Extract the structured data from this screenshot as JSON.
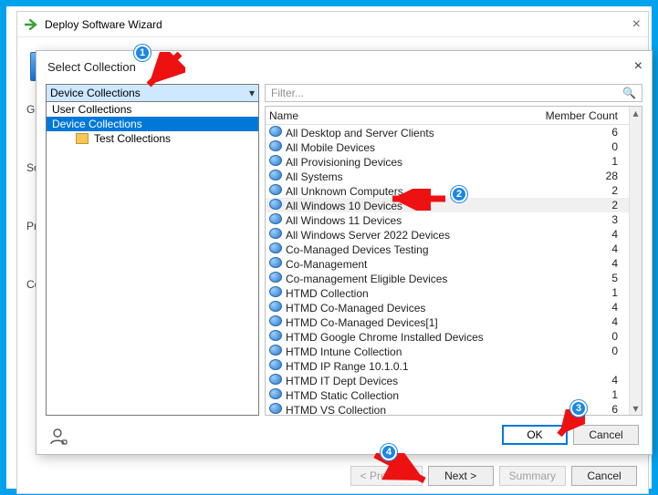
{
  "wizard": {
    "title": "Deploy Software Wizard",
    "side_labels": [
      "Ge",
      "So",
      "Pr",
      "Co"
    ],
    "buttons": {
      "previous": "< Previous",
      "next": "Next >",
      "summary": "Summary",
      "cancel": "Cancel"
    }
  },
  "modal": {
    "title": "Select Collection",
    "combo_value": "Device Collections",
    "tree": {
      "items": [
        "User Collections",
        "Device Collections"
      ],
      "sub_item": "Test Collections",
      "selected_index": 1
    },
    "filter_placeholder": "Filter...",
    "columns": {
      "name": "Name",
      "member": "Member Count"
    },
    "rows": [
      {
        "name": "All Desktop and Server Clients",
        "count": "6"
      },
      {
        "name": "All Mobile Devices",
        "count": "0"
      },
      {
        "name": "All Provisioning Devices",
        "count": "1"
      },
      {
        "name": "All Systems",
        "count": "28"
      },
      {
        "name": "All Unknown Computers",
        "count": "2"
      },
      {
        "name": "All Windows 10 Devices",
        "count": "2",
        "highlight": true
      },
      {
        "name": "All Windows 11 Devices",
        "count": "3"
      },
      {
        "name": "All Windows Server 2022 Devices",
        "count": "4"
      },
      {
        "name": "Co-Managed Devices Testing",
        "count": "4"
      },
      {
        "name": "Co-Management",
        "count": "4"
      },
      {
        "name": "Co-management Eligible Devices",
        "count": "5"
      },
      {
        "name": "HTMD Collection",
        "count": "1"
      },
      {
        "name": "HTMD Co-Managed Devices",
        "count": "4"
      },
      {
        "name": "HTMD Co-Managed Devices[1]",
        "count": "4"
      },
      {
        "name": "HTMD Google Chrome Installed Devices",
        "count": "0"
      },
      {
        "name": "HTMD Intune Collection",
        "count": "0"
      },
      {
        "name": "HTMD IP Range 10.1.0.1",
        "count": ""
      },
      {
        "name": "HTMD IT Dept Devices",
        "count": "4"
      },
      {
        "name": "HTMD Static Collection",
        "count": "1"
      },
      {
        "name": "HTMD VS Collection",
        "count": "6"
      }
    ],
    "buttons": {
      "ok": "OK",
      "cancel": "Cancel"
    }
  },
  "annotations": {
    "badges": {
      "b1": "1",
      "b2": "2",
      "b3": "3",
      "b4": "4"
    }
  }
}
